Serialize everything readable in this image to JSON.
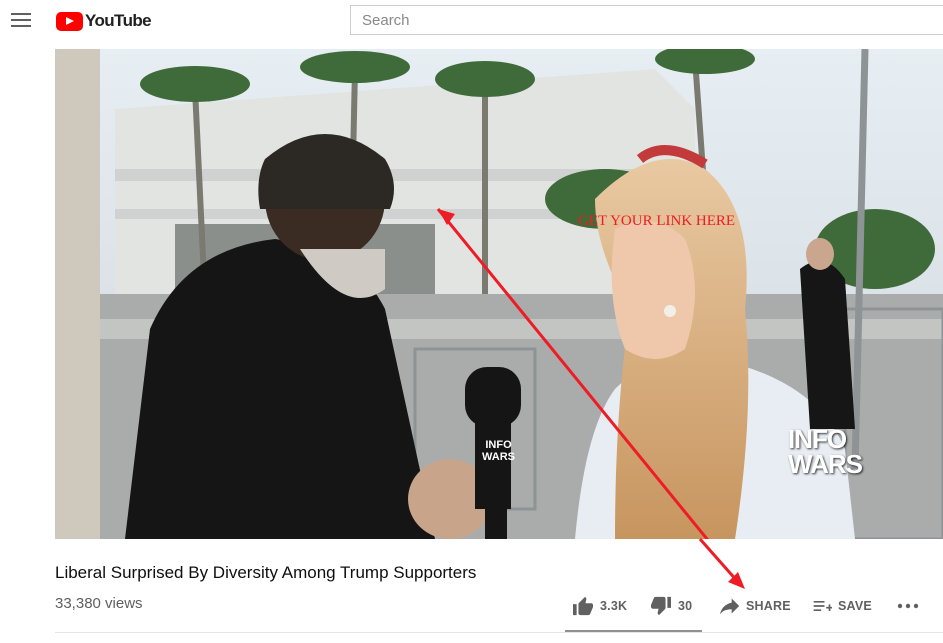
{
  "header": {
    "brand": "YouTube",
    "search_placeholder": "Search"
  },
  "video": {
    "overlay_text": "GET YOUR LINK HERE",
    "watermark_line1": "INFO",
    "watermark_line2": "WARS",
    "mic_line1": "INFO",
    "mic_line2": "WARS",
    "title": "Liberal Surprised By Diversity Among Trump Supporters",
    "views": "33,380 views"
  },
  "actions": {
    "likes": "3.3K",
    "dislikes": "30",
    "share": "SHARE",
    "save": "SAVE",
    "like_ratio": 0.99
  },
  "colors": {
    "brand_red": "#ff0000",
    "overlay_red": "#ee1c25"
  }
}
